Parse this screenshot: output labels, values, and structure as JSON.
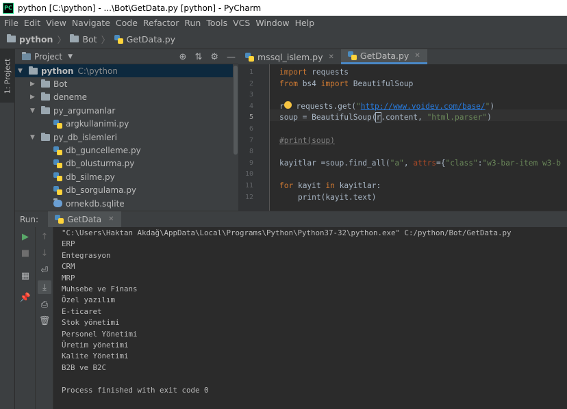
{
  "window": {
    "title": "python [C:\\python] - ...\\Bot\\GetData.py [python] - PyCharm",
    "app_icon": "PC"
  },
  "menu": [
    "File",
    "Edit",
    "View",
    "Navigate",
    "Code",
    "Refactor",
    "Run",
    "Tools",
    "VCS",
    "Window",
    "Help"
  ],
  "breadcrumb": {
    "root": "python",
    "folder": "Bot",
    "file": "GetData.py"
  },
  "sidebar_tab": "1: Project",
  "project": {
    "header": "Project",
    "items": [
      {
        "label": "python",
        "path": "C:\\python",
        "type": "folder",
        "open": true
      },
      {
        "label": "Bot",
        "type": "folder",
        "open": false
      },
      {
        "label": "deneme",
        "type": "folder",
        "open": false
      },
      {
        "label": "py_argumanlar",
        "type": "folder",
        "open": true
      },
      {
        "label": "argkullanimi.py",
        "type": "py"
      },
      {
        "label": "py_db_islemleri",
        "type": "folder",
        "open": true
      },
      {
        "label": "db_guncelleme.py",
        "type": "py"
      },
      {
        "label": "db_olusturma.py",
        "type": "py"
      },
      {
        "label": "db_silme.py",
        "type": "py"
      },
      {
        "label": "db_sorgulama.py",
        "type": "py"
      },
      {
        "label": "ornekdb.sqlite",
        "type": "sqlite"
      }
    ]
  },
  "editor": {
    "tabs": [
      {
        "label": "mssql_islem.py",
        "active": false
      },
      {
        "label": "GetData.py",
        "active": true
      }
    ],
    "line_numbers": [
      "1",
      "2",
      "3",
      "4",
      "5",
      "6",
      "7",
      "8",
      "9",
      "10",
      "11",
      "12"
    ],
    "code": {
      "l1_kw": "import",
      "l1_rest": " requests",
      "l2_kw1": "from",
      "l2_mid": " bs4 ",
      "l2_kw2": "import",
      "l2_rest": " BeautifulSoup",
      "l4_a": "r",
      "l4_b": " requests.get(",
      "l4_q1": "\"",
      "l4_url": "http://www.voidev.com/base/",
      "l4_q2": "\"",
      "l4_c": ")",
      "l5_a": "soup = BeautifulSoup(",
      "l5_b": "r",
      "l5_c": ".content, ",
      "l5_str": "\"html.parser\"",
      "l5_d": ")",
      "l7": "#print(soup)",
      "l9_a": "kayitlar =soup.find_all(",
      "l9_s1": "\"a\"",
      "l9_b": ", ",
      "l9_kw": "attrs",
      "l9_c": "={",
      "l9_s2": "\"class\"",
      "l9_d": ":",
      "l9_s3": "\"w3-bar-item w3-b",
      "l11_kw1": "for",
      "l11_a": " kayit ",
      "l11_kw2": "in",
      "l11_b": " kayitlar:",
      "l12": "    print(kayit.text)"
    }
  },
  "run": {
    "label": "Run:",
    "tab": "GetData",
    "output": [
      "\"C:\\Users\\Haktan Akdağ\\AppData\\Local\\Programs\\Python\\Python37-32\\python.exe\" C:/python/Bot/GetData.py",
      "ERP",
      "Entegrasyon",
      "CRM",
      "MRP",
      "Muhsebe ve Finans",
      "Özel yazılım",
      "E-ticaret",
      "Stok yönetimi",
      "Personel Yönetimi",
      "Üretim yönetimi",
      "Kalite Yönetimi",
      "B2B ve B2C",
      "",
      "Process finished with exit code 0"
    ]
  },
  "colors": {
    "keyword": "#cc7832",
    "string": "#6a8759",
    "comment": "#808080",
    "run_green": "#59a869"
  }
}
